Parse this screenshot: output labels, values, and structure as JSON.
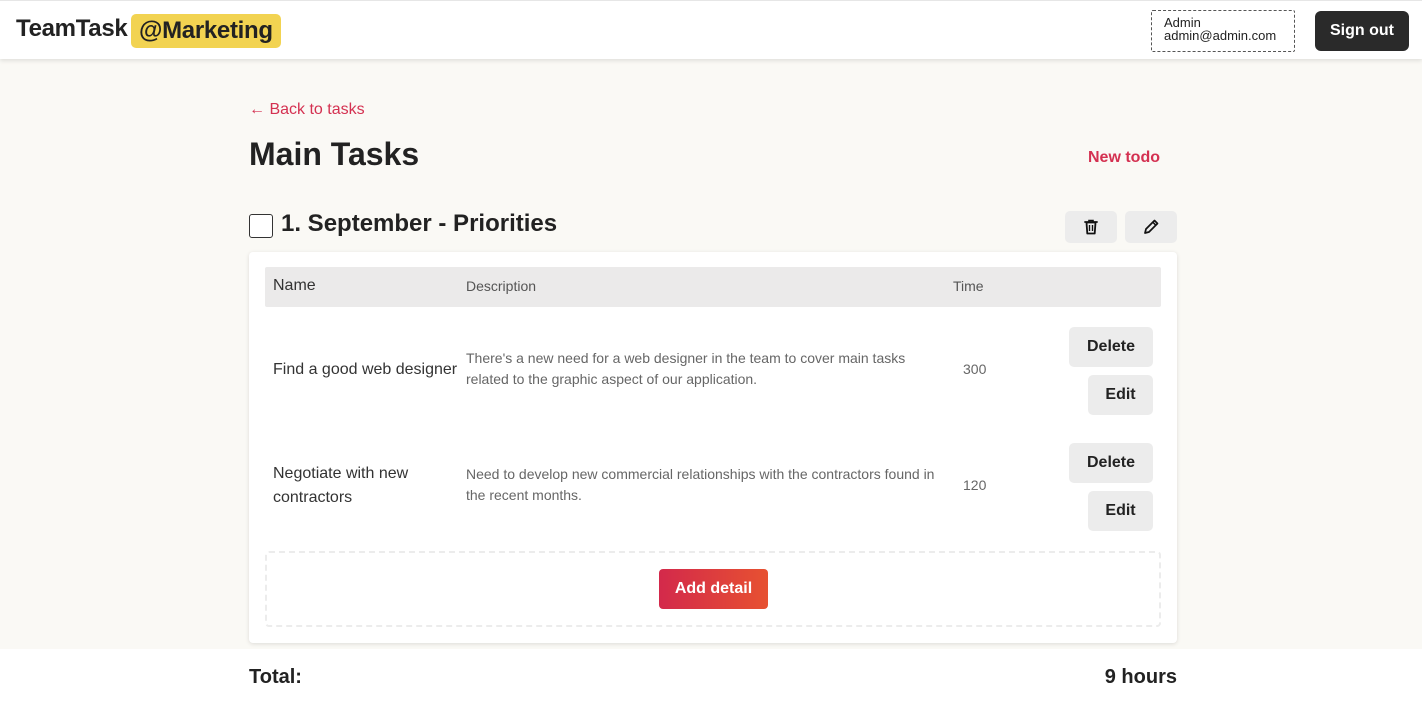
{
  "header": {
    "brand": "TeamTask",
    "team": "@Marketing",
    "user_name": "Admin",
    "user_email": "admin@admin.com",
    "signout_label": "Sign out"
  },
  "page": {
    "back_link": "← Back to tasks",
    "title": "Main Tasks",
    "new_todo": "New todo"
  },
  "todo": {
    "title": "1. September - Priorities",
    "checked": false,
    "columns": {
      "name": "Name",
      "description": "Description",
      "time": "Time"
    },
    "rows": [
      {
        "name": "Find a good web designer",
        "description": "There's a new need for a web designer in the team to cover main tasks related to the graphic aspect of our application.",
        "time": "300",
        "delete_label": "Delete",
        "edit_label": "Edit"
      },
      {
        "name": "Negotiate with new contractors",
        "description": "Need to develop new commercial relationships with the contractors found in the recent months.",
        "time": "120",
        "delete_label": "Delete",
        "edit_label": "Edit"
      }
    ],
    "add_detail": "Add detail"
  },
  "total": {
    "label": "Total:",
    "value": "9 hours"
  },
  "icons": [
    "trash-icon",
    "pencil-icon",
    "checkbox-icon"
  ],
  "colors": {
    "accent": "#d43151",
    "badge": "#f2d351",
    "dark_button": "#2a2a2a"
  }
}
